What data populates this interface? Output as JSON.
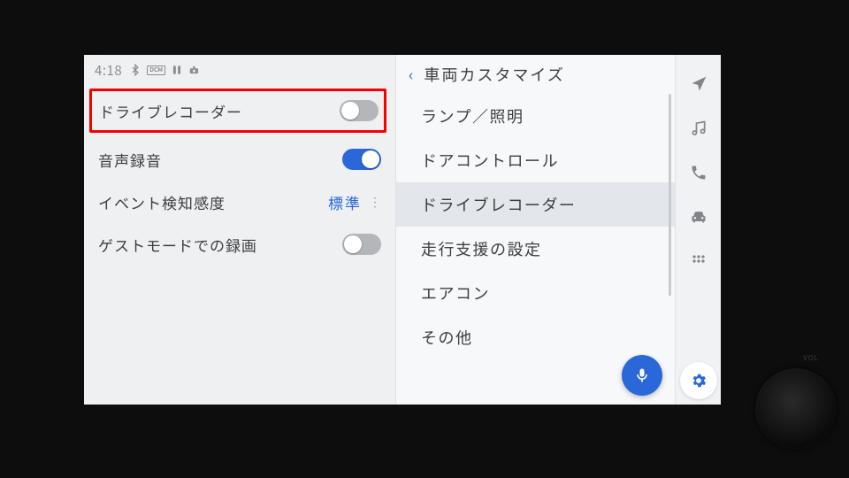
{
  "status": {
    "time": "4:18"
  },
  "left": {
    "settings": [
      {
        "label": "ドライブレコーダー",
        "type": "toggle",
        "state": "off",
        "highlighted": true
      },
      {
        "label": "音声録音",
        "type": "toggle",
        "state": "on"
      },
      {
        "label": "イベント検知感度",
        "type": "value",
        "value": "標準"
      },
      {
        "label": "ゲストモードでの録画",
        "type": "toggle",
        "state": "off"
      }
    ]
  },
  "right": {
    "title": "車両カスタマイズ",
    "items": [
      {
        "label": "ランプ／照明"
      },
      {
        "label": "ドアコントロール"
      },
      {
        "label": "ドライブレコーダー",
        "selected": true
      },
      {
        "label": "走行支援の設定"
      },
      {
        "label": "エアコン"
      },
      {
        "label": "その他"
      }
    ]
  },
  "volume_label": "VOL"
}
